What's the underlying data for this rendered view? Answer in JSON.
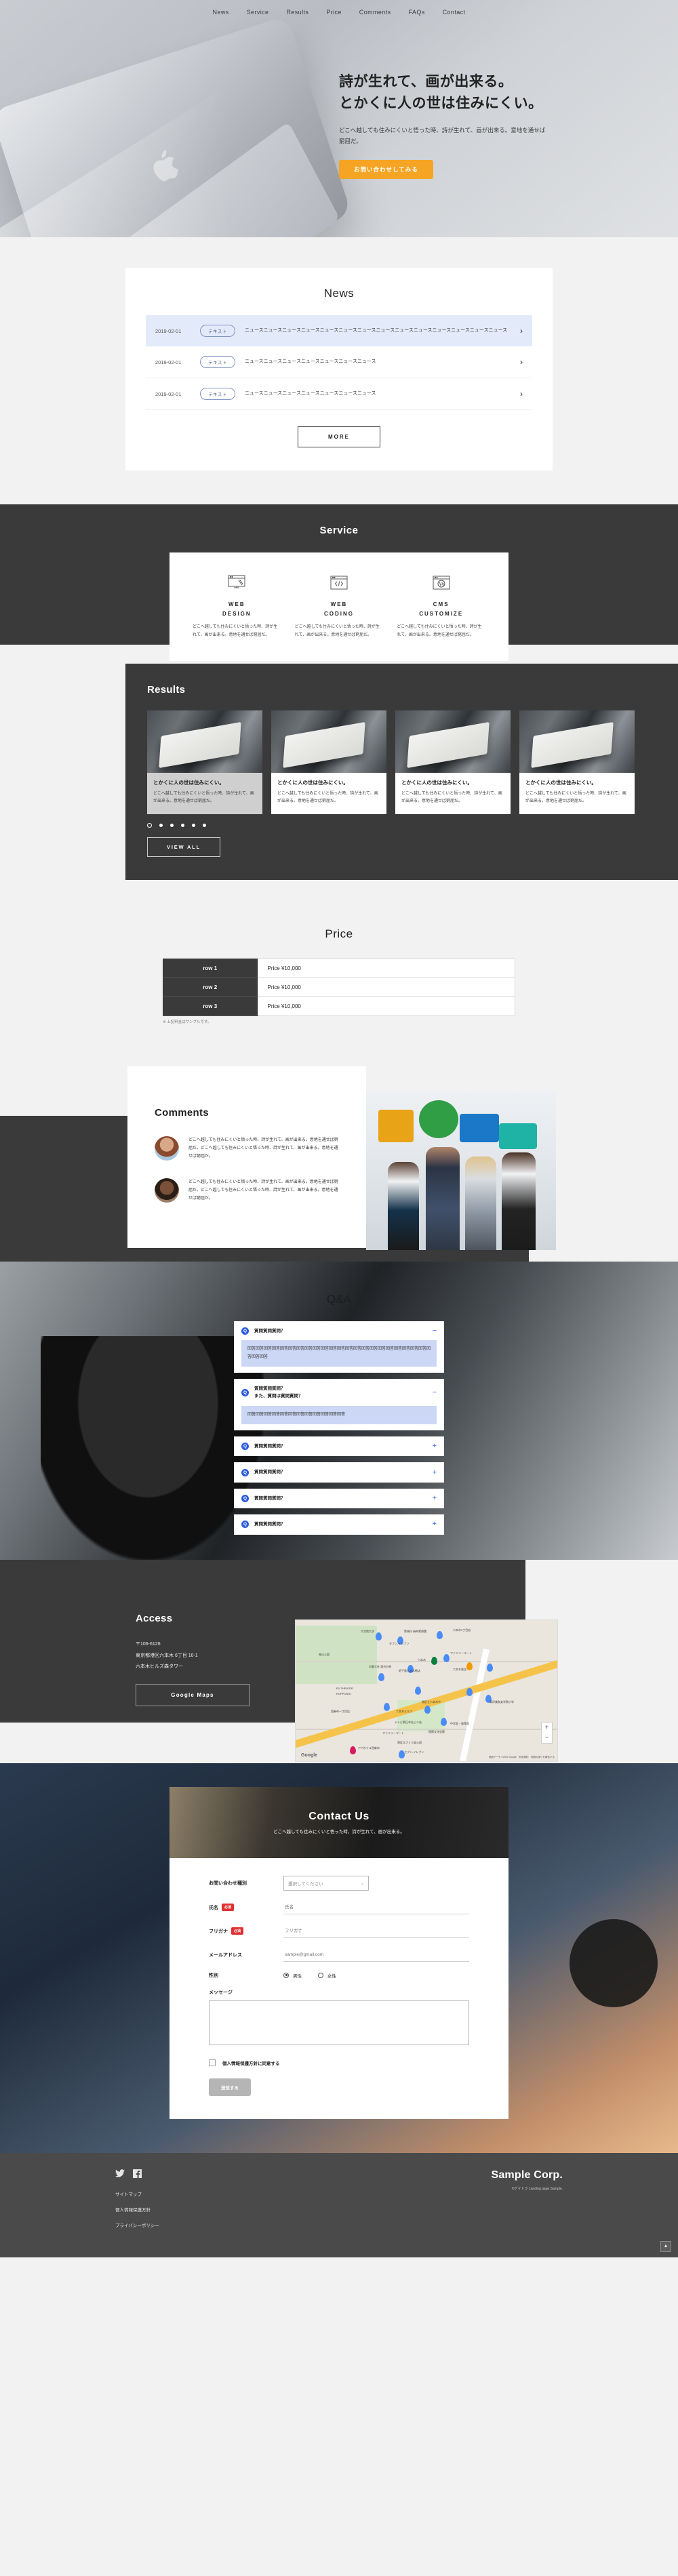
{
  "nav": {
    "items": [
      {
        "label": "News"
      },
      {
        "label": "Service"
      },
      {
        "label": "Results"
      },
      {
        "label": "Price"
      },
      {
        "label": "Comments"
      },
      {
        "label": "FAQs"
      },
      {
        "label": "Contact"
      }
    ]
  },
  "hero": {
    "headline_line1": "詩が生れて、画が出来る。",
    "headline_line2": "とかくに人の世は住みにくい。",
    "subtext": "どこへ越しても住みにくいと悟った時、詩が生れて、画が出来る。意地を通せば窮屈だ。",
    "cta_label": "お問い合わせしてみる",
    "cta_color": "#f5a423"
  },
  "news": {
    "title": "News",
    "items": [
      {
        "date": "2019-02-01",
        "tag": "テキスト",
        "text": "ニュースニュースニュースニュースニュースニュースニュースニュースニュースニュースニュースニュースニュースニュース",
        "arrow": "chevron-right-icon",
        "active": true
      },
      {
        "date": "2019-02-01",
        "tag": "テキスト",
        "text": "ニュースニュースニュースニュースニュースニュースニュース",
        "arrow": "chevron-right-icon",
        "active": false
      },
      {
        "date": "2019-02-01",
        "tag": "テキスト",
        "text": "ニュースニュースニュースニュースニュースニュースニュース",
        "arrow": "chevron-right-icon",
        "active": false
      }
    ],
    "more_label": "MORE"
  },
  "service": {
    "title": "Service",
    "cards": [
      {
        "icon": "monitor-design-icon",
        "name_line1": "WEB",
        "name_line2": "DESIGN",
        "desc": "どこへ越しても住みにくいと悟った時、詩が生れて、画が出来る。意地を通せば窮屈だ。"
      },
      {
        "icon": "code-browser-icon",
        "name_line1": "WEB",
        "name_line2": "CODING",
        "desc": "どこへ越しても住みにくいと悟った時、詩が生れて、画が出来る。意地を通せば窮屈だ。"
      },
      {
        "icon": "wordpress-browser-icon",
        "name_line1": "CMS",
        "name_line2": "CUSTOMIZE",
        "desc": "どこへ越しても住みにくいと悟った時、詩が生れて、画が出来る。意地を通せば窮屈だ。"
      }
    ]
  },
  "results": {
    "title": "Results",
    "slides": [
      {
        "title": "とかくに人の世は住みにくい。",
        "desc": "どこへ越しても住みにくいと悟った時、詩が生れて、画が出来る。意地を通せば窮屈だ。"
      },
      {
        "title": "とかくに人の世は住みにくい。",
        "desc": "どこへ越しても住みにくいと悟った時、詩が生れて、画が出来る。意地を通せば窮屈だ。"
      },
      {
        "title": "とかくに人の世は住みにくい。",
        "desc": "どこへ越しても住みにくいと悟った時、詩が生れて、画が出来る。意地を通せば窮屈だ。"
      },
      {
        "title": "とかくに人の世は住みにくい。",
        "desc": "どこへ越しても住みにくいと悟った時、詩が生れて、画が出来る。意地を通せば窮屈だ。"
      }
    ],
    "dot_count": 6,
    "active_dot": 0,
    "view_all_label": "VIEW ALL"
  },
  "price": {
    "title": "Price",
    "rows": [
      {
        "label": "row 1",
        "value": "Price ¥10,000"
      },
      {
        "label": "row 2",
        "value": "Price ¥10,000"
      },
      {
        "label": "row 3",
        "value": "Price ¥10,000"
      }
    ],
    "note": "※ 上記料金はサンプルです。"
  },
  "comments": {
    "title": "Comments",
    "items": [
      {
        "avatar": "avatar-woman",
        "text": "どこへ越しても住みにくいと悟った時、詩が生れて、画が出来る。意地を通せば窮屈だ。どこへ越しても住みにくいと悟った時、詩が生れて、画が出来る。意地を通せば窮屈だ。"
      },
      {
        "avatar": "avatar-man",
        "text": "どこへ越しても住みにくいと悟った時、詩が生れて、画が出来る。意地を通せば窮屈だ。どこへ越しても住みにくいと悟った時、詩が生れて、画が出来る。意地を通せば窮屈だ。"
      }
    ]
  },
  "qa": {
    "title": "Q&A",
    "badge": "Q",
    "items": [
      {
        "question": "質問質問質問？",
        "question2": "",
        "answer": "回答回答回答回答回答回答回答回答回答回答回答回答回答回答回答回答回答回答回答回答回答回答回答回答回答",
        "open": true,
        "toggle": "−"
      },
      {
        "question": "質問質問質問？",
        "question2": "また、質問は質問質問？",
        "answer": "回答回答回答回答回答回答回答回答回答回答回答回答",
        "open": true,
        "toggle": "−"
      },
      {
        "question": "質問質問質問？",
        "question2": "",
        "answer": "",
        "open": false,
        "toggle": "+"
      },
      {
        "question": "質問質問質問？",
        "question2": "",
        "answer": "",
        "open": false,
        "toggle": "+"
      },
      {
        "question": "質問質問質問？",
        "question2": "",
        "answer": "",
        "open": false,
        "toggle": "+"
      },
      {
        "question": "質問質問質問？",
        "question2": "",
        "answer": "",
        "open": false,
        "toggle": "+"
      }
    ]
  },
  "access": {
    "title": "Access",
    "postal": "〒106-6126",
    "address1": "東京都港区六本木 6丁目 10-1",
    "address2": "六本木ヒルズ森タワー",
    "maps_button": "Google Maps",
    "map": {
      "labels": [
        "政策研究\n大学院大学",
        "警視庁 麻布警察署",
        "六本木3丁目店",
        "セブン-イレブン\n六本木駅北店",
        "ファミリーマート\n六本木駅前店",
        "青山公園\n南地区",
        "六本木",
        "出雲大社 東京分祠",
        "ファミリーマート\n地下鉄六本木駅店",
        "セブン-イレブン\n六本木5丁目店",
        "ファミリーマ\n六本木東店",
        "EX THEATER\nROPPONGI",
        "港区立六本木中",
        "東洋英和女学院小学",
        "ファミリーマート\n西麻布一丁目店",
        "六本木ヒルズ",
        "セブン-イレブン TFS\nテレビ朝日本社ビル店",
        "東洋英和女学院\n中学部・高等部",
        "ファミリーマート\n西麻布三丁目店",
        "国際文化会館",
        "ファミリーマート\n六本木テレ朝通り店",
        "港区立さくら\n坂公園",
        "アパホテル西麻布",
        "セブン-イレブン\n西麻布3丁目店",
        "港区立青山小",
        "西十三通り 東十四通り",
        "西麻布",
        "港区"
      ],
      "zoom_in": "+",
      "zoom_out": "−",
      "attribution": "地図データ ©2022 Google　利用規約　地図の誤りを報告する",
      "logo": "Google"
    }
  },
  "contact": {
    "title": "Contact Us",
    "subtitle": "どこへ越しても住みにくいと悟った時、詩が生れて、画が出来る。",
    "fields": {
      "type_label": "お問い合わせ種別",
      "type_value": "選択してください",
      "name_label": "氏名",
      "name_required": "必須",
      "name_placeholder": "氏名",
      "kana_label": "フリガナ",
      "kana_required": "必須",
      "kana_placeholder": "フリガナ",
      "email_label": "メールアドレス",
      "email_placeholder": "sample@gmail.com",
      "gender_label": "性別",
      "gender_male": "男性",
      "gender_female": "女性",
      "gender_selected": "男性",
      "message_label": "メッセージ",
      "message_value": "",
      "agree_label": "個人情報保護方針に同意する",
      "agree_checked": false,
      "submit_label": "送信する"
    }
  },
  "footer": {
    "social": [
      {
        "icon": "twitter-icon",
        "glyph": "🐦"
      },
      {
        "icon": "facebook-icon",
        "glyph": "f"
      }
    ],
    "links": [
      {
        "label": "サイトマップ"
      },
      {
        "label": "個人情報保護方針"
      },
      {
        "label": "プライバシーポリシー"
      }
    ],
    "brand": "Sample Corp.",
    "copyright": "©デイトラ Landing page Sample.",
    "back_to_top": "▲"
  }
}
